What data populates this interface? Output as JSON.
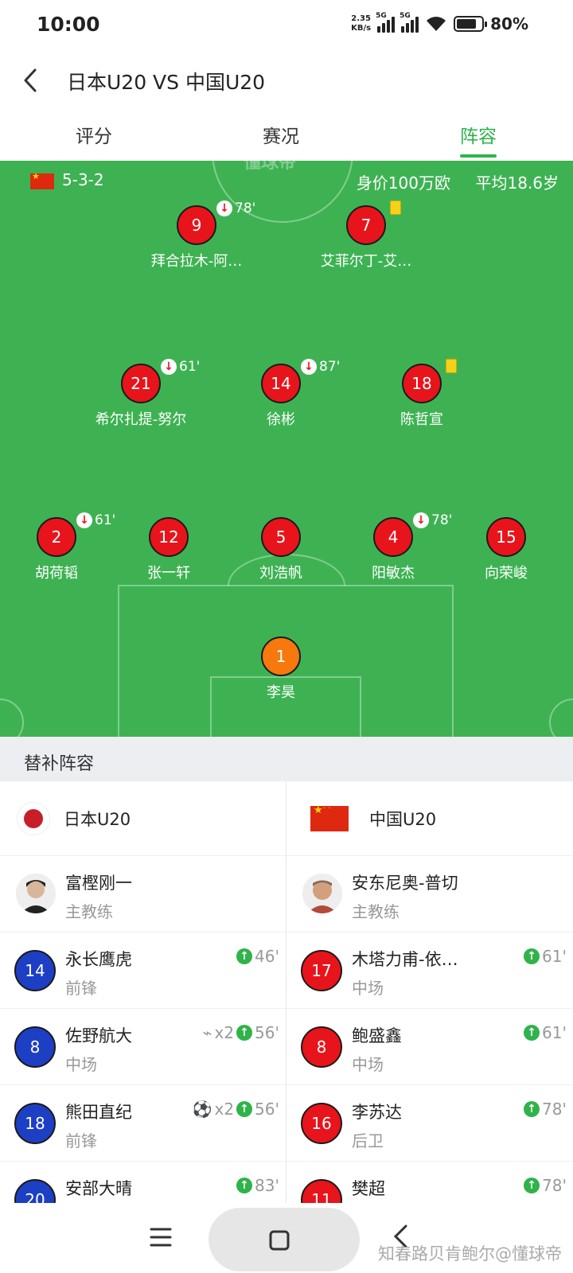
{
  "status_bar": {
    "time": "10:00",
    "speed": "2.35\nKB/s",
    "net1": "5G",
    "net2": "5G",
    "battery": "80%"
  },
  "header": {
    "title": "日本U20 VS 中国U20"
  },
  "tabs": [
    {
      "label": "评分"
    },
    {
      "label": "赛况"
    },
    {
      "label": "阵容",
      "active": true
    }
  ],
  "pitch": {
    "watermark": "懂球帝",
    "formation": "5-3-2",
    "value": "身价100万欧",
    "avg_age": "平均18.6岁",
    "players": [
      {
        "num": "9",
        "name": "拜合拉木-阿…",
        "sub": "78'"
      },
      {
        "num": "7",
        "name": "艾菲尔丁-艾…",
        "card": "yellow"
      },
      {
        "num": "21",
        "name": "希尔扎提-努尔",
        "sub": "61'"
      },
      {
        "num": "14",
        "name": "徐彬",
        "sub": "87'"
      },
      {
        "num": "18",
        "name": "陈哲宣",
        "card": "yellow"
      },
      {
        "num": "2",
        "name": "胡荷韬",
        "sub": "61'"
      },
      {
        "num": "12",
        "name": "张一轩"
      },
      {
        "num": "5",
        "name": "刘浩帆"
      },
      {
        "num": "4",
        "name": "阳敏杰",
        "sub": "78'"
      },
      {
        "num": "15",
        "name": "向荣峻"
      },
      {
        "num": "1",
        "name": "李昊",
        "gk": true
      }
    ]
  },
  "subs": {
    "heading": "替补阵容",
    "left": {
      "team": "日本U20",
      "coach": {
        "name": "富樫刚一",
        "role": "主教练"
      },
      "players": [
        {
          "num": "14",
          "name": "永长鹰虎",
          "role": "前锋",
          "tag": "46'"
        },
        {
          "num": "8",
          "name": "佐野航大",
          "role": "中场",
          "extra": "x2",
          "extra_icon": "boot-icon",
          "tag": "56'"
        },
        {
          "num": "18",
          "name": "熊田直纪",
          "role": "前锋",
          "extra": "x2",
          "extra_icon": "ball-icon",
          "tag": "56'"
        },
        {
          "num": "20",
          "name": "安部大晴",
          "role": "",
          "tag": "83'"
        }
      ]
    },
    "right": {
      "team": "中国U20",
      "coach": {
        "name": "安东尼奥-普切",
        "role": "主教练"
      },
      "players": [
        {
          "num": "17",
          "name": "木塔力甫-依…",
          "role": "中场",
          "tag": "61'"
        },
        {
          "num": "8",
          "name": "鲍盛鑫",
          "role": "中场",
          "tag": "61'"
        },
        {
          "num": "16",
          "name": "李苏达",
          "role": "后卫",
          "tag": "78'"
        },
        {
          "num": "11",
          "name": "樊超",
          "role": "",
          "tag": "78'"
        }
      ]
    }
  },
  "watermark": "知春路贝肯鲍尔@懂球帝",
  "colors": {
    "accent": "#2fb34a",
    "pitch": "#3eb253",
    "china_red": "#e8141b",
    "japan_blue": "#1d3fc4",
    "gk": "#f7780d"
  }
}
